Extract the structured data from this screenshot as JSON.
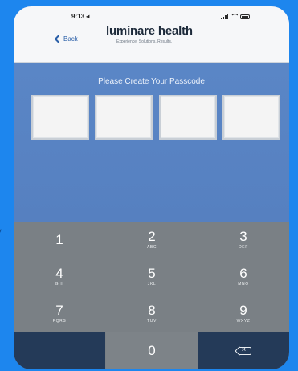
{
  "status_bar": {
    "time": "9:13 ◂",
    "icons": [
      "signal-icon",
      "wifi-icon",
      "battery-icon"
    ]
  },
  "header": {
    "back_label": "Back",
    "logo": "luminare health",
    "tagline": "Experience. Solutions. Results."
  },
  "passcode": {
    "prompt": "Please Create Your Passcode",
    "boxes": [
      "",
      "",
      "",
      ""
    ]
  },
  "keypad": {
    "keys": [
      {
        "digit": "1",
        "letters": ""
      },
      {
        "digit": "2",
        "letters": "ABC"
      },
      {
        "digit": "3",
        "letters": "DEF"
      },
      {
        "digit": "4",
        "letters": "GHI"
      },
      {
        "digit": "5",
        "letters": "JKL"
      },
      {
        "digit": "6",
        "letters": "MNO"
      },
      {
        "digit": "7",
        "letters": "PQRS"
      },
      {
        "digit": "8",
        "letters": "TUV"
      },
      {
        "digit": "9",
        "letters": "WXYZ"
      },
      {
        "digit": "",
        "letters": ""
      },
      {
        "digit": "0",
        "letters": ""
      },
      {
        "digit": "",
        "letters": "",
        "icon": "delete-backspace-icon"
      }
    ]
  },
  "colors": {
    "background": "#1d86ee",
    "passcode_bg": "#5a86c6",
    "keypad_bg": "#7a8085",
    "dark_key": "#243a58"
  }
}
